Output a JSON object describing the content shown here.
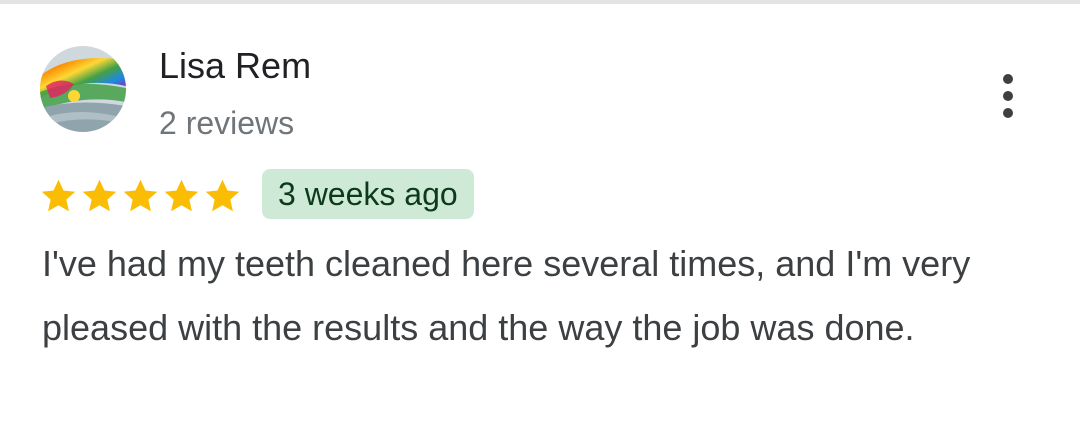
{
  "reviewer": {
    "name": "Lisa Rem",
    "meta": "2 reviews",
    "avatar_icon": "rainbow-landscape-avatar"
  },
  "more_options_icon": "more-vert-icon",
  "rating": {
    "stars": 5,
    "max": 5,
    "star_color": "#fbbc04"
  },
  "time_ago": "3 weeks ago",
  "badge_color": "#ceead6",
  "review_text": "I've had my teeth cleaned here several times, and I'm very pleased with the results and the way the job was done."
}
